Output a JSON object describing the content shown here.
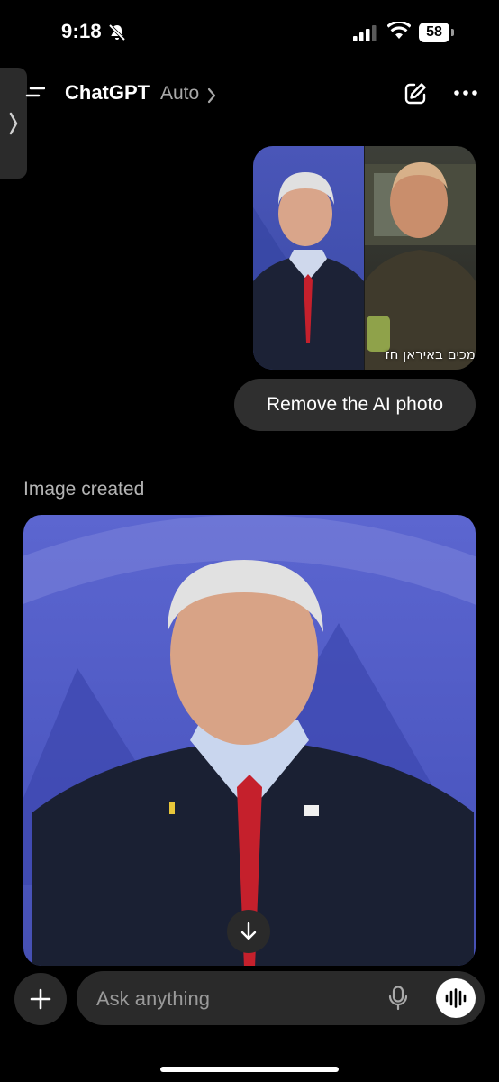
{
  "status_bar": {
    "time": "9:18",
    "battery": "58"
  },
  "header": {
    "title": "ChatGPT",
    "model": "Auto",
    "model_chevron": "›"
  },
  "sent_image": {
    "caption_text": "מכים באיראן חז"
  },
  "user_message": {
    "text": "Remove the AI photo"
  },
  "assistant": {
    "status_label": "Image created"
  },
  "composer": {
    "placeholder": "Ask anything"
  },
  "colors": {
    "background": "#000000",
    "bubble": "#2f2f2f",
    "input_bg": "#2a2a2a",
    "muted_text": "#b4b4b4",
    "image_blue": "#5c66d0"
  },
  "icons": [
    "bell-slash-icon",
    "signal-icon",
    "wifi-icon",
    "battery-icon",
    "chevron-right-icon",
    "menu-icon",
    "edit-icon",
    "more-icon",
    "arrow-down-icon",
    "plus-icon",
    "microphone-icon",
    "voice-waveform-icon"
  ]
}
